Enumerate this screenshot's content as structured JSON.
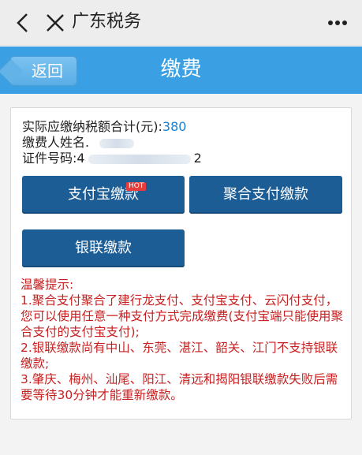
{
  "topbar": {
    "title": "广东税务",
    "icons": [
      "chevron-left-icon",
      "close-icon",
      "more-icon"
    ]
  },
  "header": {
    "back_label": "返回",
    "title": "缴费",
    "bg_color": "#3aa0e3"
  },
  "info": {
    "amount_label": "实际应缴纳税额合计(元):",
    "amount_value": "380",
    "payer_label": "缴费人姓名.",
    "id_label": "证件号码:",
    "id_prefix": "4",
    "id_suffix": "2"
  },
  "buttons": {
    "alipay": "支付宝缴款",
    "alipay_badge": "HOT",
    "aggregate": "聚合支付缴款",
    "unionpay": "银联缴款"
  },
  "tips": {
    "heading": "温馨提示:",
    "items": [
      "1.聚合支付聚合了建行龙支付、支付宝支付、云闪付支付，您可以使用任意一种支付方式完成缴费(支付宝端只能使用聚合支付的支付宝支付);",
      "2.银联缴款尚有中山、东莞、湛江、韶关、江门不支持银联缴款;",
      "3.肇庆、梅州、汕尾、阳江、清远和揭阳银联缴款失败后需要等待30分钟才能重新缴款。"
    ]
  },
  "colors": {
    "button": "#1c5d96",
    "tips": "#c82020",
    "amount": "#1a7fd0"
  }
}
